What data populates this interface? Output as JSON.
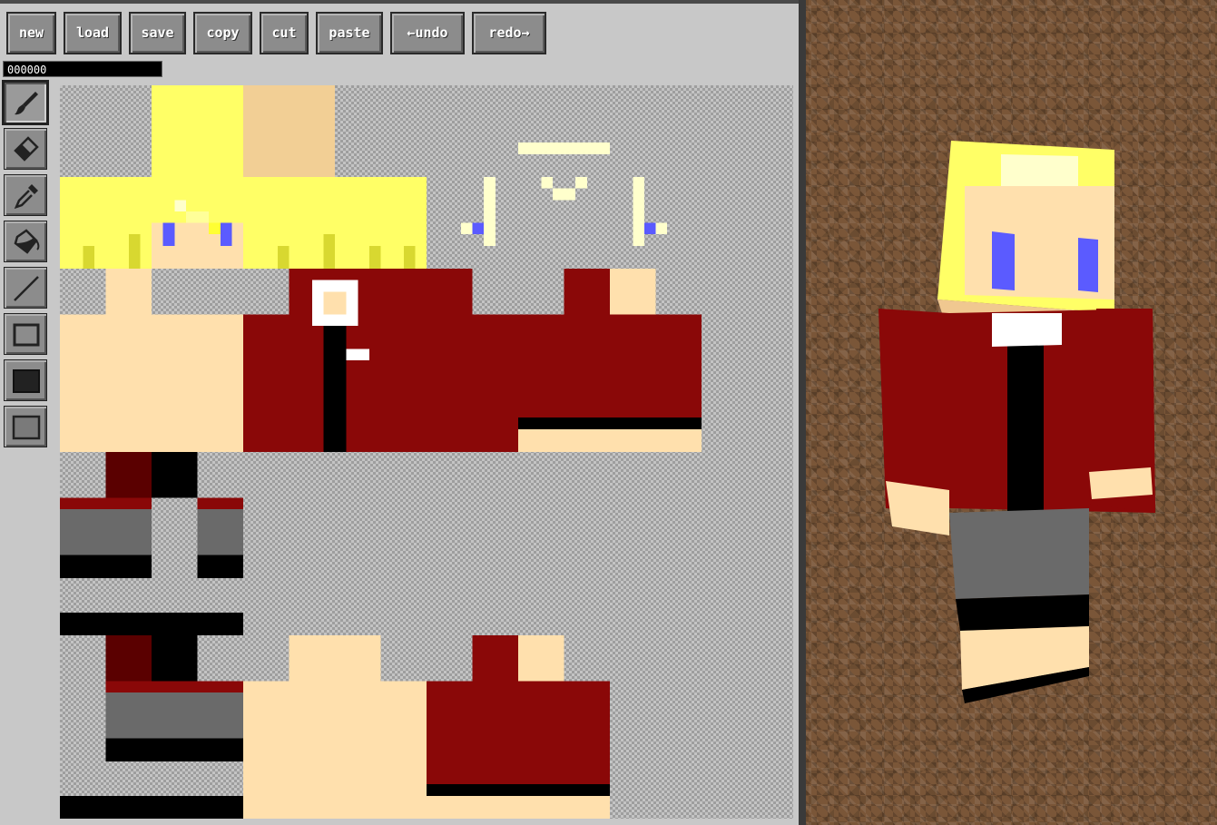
{
  "toolbar": {
    "new_label": "new",
    "load_label": "load",
    "save_label": "save",
    "copy_label": "copy",
    "cut_label": "cut",
    "paste_label": "paste",
    "undo_label": "←undo",
    "redo_label": "redo→"
  },
  "color_field": {
    "value": "000000"
  },
  "tools": [
    {
      "name": "brush",
      "icon": "brush-icon",
      "active": true
    },
    {
      "name": "eraser",
      "icon": "eraser-icon",
      "active": false
    },
    {
      "name": "eyedropper",
      "icon": "eyedropper-icon",
      "active": false
    },
    {
      "name": "fill",
      "icon": "fill-bucket-icon",
      "active": false
    },
    {
      "name": "line",
      "icon": "line-icon",
      "active": false
    },
    {
      "name": "rectangle",
      "icon": "rectangle-outline-icon",
      "active": false
    },
    {
      "name": "filled-rectangle",
      "icon": "rectangle-filled-icon",
      "active": false
    },
    {
      "name": "rectangle-alt",
      "icon": "rectangle-gray-icon",
      "active": false
    }
  ],
  "colors": {
    "hair": "#ffff66",
    "hair_dark": "#d8d830",
    "skin": "#ffe0ad",
    "skin_top": "#f2cf95",
    "jacket": "#8a0808",
    "jacket_dark": "#5a0000",
    "black": "#000000",
    "white": "#ffffff",
    "eye": "#5b5bff",
    "cream": "#ffffcc",
    "skirt": "#6a6a6a",
    "skirt_light": "#b0b0b0",
    "panel_bg": "#c8c8c8",
    "dirt": "#7a5638"
  }
}
